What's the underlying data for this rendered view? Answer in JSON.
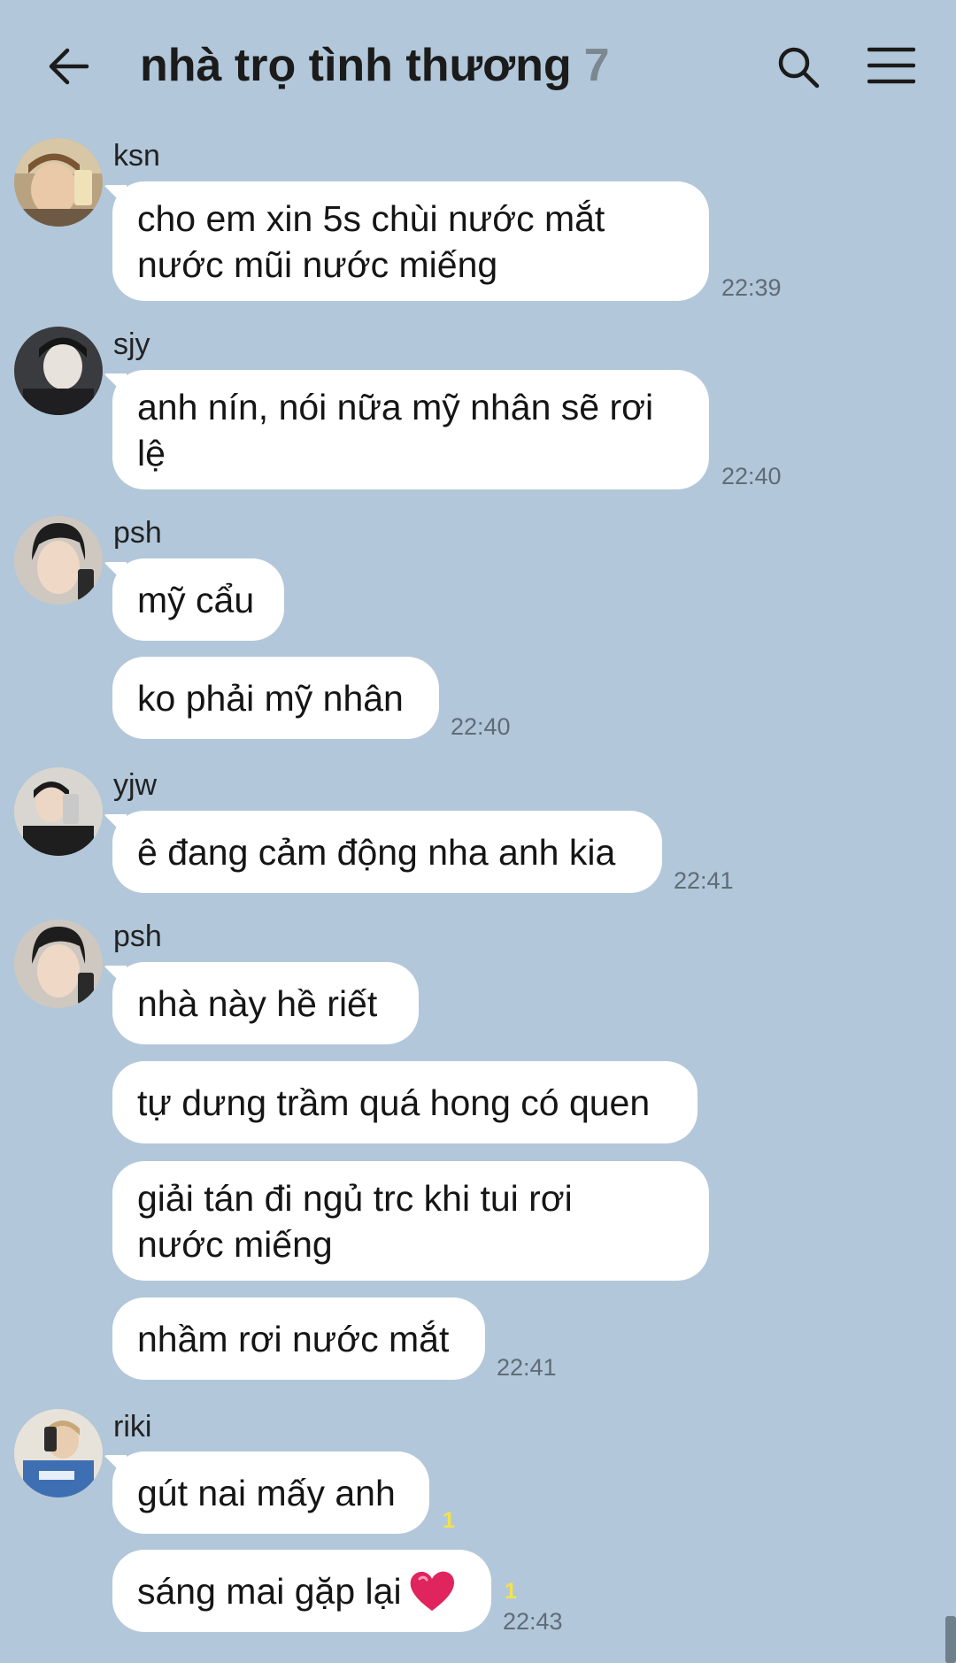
{
  "header": {
    "title": "nhà trọ tình thương",
    "member_count": "7",
    "back_icon": "arrow-left-icon",
    "search_icon": "search-icon",
    "menu_icon": "hamburger-menu-icon"
  },
  "messages": [
    {
      "sender": "ksn",
      "bubbles": [
        "cho em xin 5s chùi nước mắt\nnước mũi nước miếng"
      ],
      "time": "22:39"
    },
    {
      "sender": "sjy",
      "bubbles": [
        "anh nín, nói nữa mỹ nhân sẽ rơi\nlệ"
      ],
      "time": "22:40"
    },
    {
      "sender": "psh",
      "bubbles": [
        "mỹ cẩu",
        "ko phải mỹ nhân"
      ],
      "time": "22:40"
    },
    {
      "sender": "yjw",
      "bubbles": [
        "ê đang cảm động nha anh kia"
      ],
      "time": "22:41"
    },
    {
      "sender": "psh",
      "bubbles": [
        "nhà này hề riết",
        "tự dưng trầm quá hong có quen",
        "giải tán đi ngủ trc khi tui rơi\nnước miếng",
        "nhầm rơi nước mắt"
      ],
      "time": "22:41"
    },
    {
      "sender": "riki",
      "bubbles": [
        "gút nai mấy anh",
        "sáng mai gặp lại"
      ],
      "unread": [
        "1",
        "1"
      ],
      "time": "22:43"
    }
  ],
  "colors": {
    "background": "#b2c7d9",
    "bubble": "#ffffff",
    "unread": "#f4e34a"
  },
  "emoji": "heart-emoji"
}
